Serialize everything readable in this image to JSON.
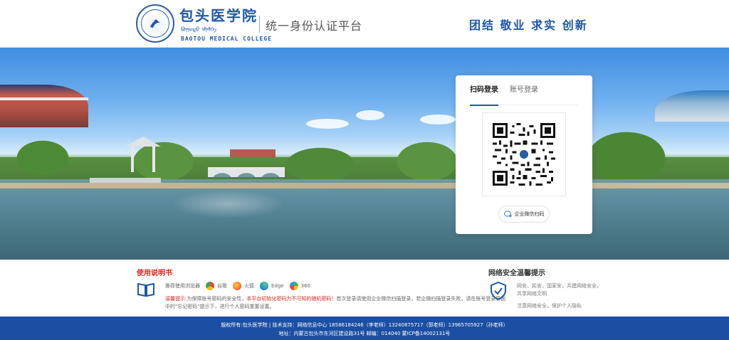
{
  "header": {
    "school_name_cn": "包头医学院",
    "school_name_mn": "ᠪᠤᠭᠤᠲᠤ ᠡᠮᠨᠡᠯᠭᠡ",
    "school_name_en": "BAOTOU MEDICAL COLLEGE",
    "platform_title": "统一身份认证平台",
    "motto": "团结 敬业 求实 创新"
  },
  "login": {
    "tabs": [
      {
        "label": "扫码登录",
        "active": true
      },
      {
        "label": "账号登录",
        "active": false
      }
    ],
    "wechat_button": "企业微信扫码"
  },
  "manual": {
    "title": "使用说明书",
    "browser_prefix": "推荐使用浏览器",
    "browsers": [
      {
        "name": "谷歌",
        "color": "#4285f4"
      },
      {
        "name": "火狐",
        "color": "#ff7139"
      },
      {
        "name": "Edge",
        "color": "#1f8fd6"
      },
      {
        "name": "360",
        "color": "#3fb34f"
      }
    ],
    "tip_key": "温馨提示:",
    "tip_part1": "为保障账号密码的安全性，",
    "tip_red": "本平台初始化密码为不可知的随机密码！",
    "tip_part2": "首次登录请使用企业微信扫描登录，若企微扫描登录失败，请在账号登录界面中的\"忘记密码\"提示下，进行个人密码重置设置。"
  },
  "security": {
    "title": "网络安全温馨提示",
    "text1": "网安、民安，国家安，共建网络安全，共享网络文明",
    "text2": "注意网络安全，保护个人隐私"
  },
  "footer": {
    "line1": "版权所有:包头医学院 | 技术支持：网络信息中心 18586184246（李老师）13240875717（郭老师）13965705927（孙老师）",
    "line2": "地址：内蒙古包头市东河区建设路31号 邮编：014040 蒙ICP备14002131号"
  },
  "colors": {
    "brand_blue": "#1d57a8",
    "footer_blue": "#1b4fa3",
    "alert_red": "#d9261c"
  }
}
